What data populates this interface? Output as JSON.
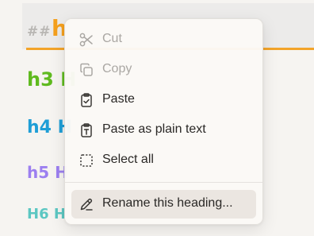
{
  "headings": {
    "h2": {
      "marker": "##",
      "text": "h"
    },
    "h3": {
      "text": "h3 H"
    },
    "h4": {
      "text": "h4 H"
    },
    "h5": {
      "text": "h5 H"
    },
    "h6": {
      "text": "H6 H"
    }
  },
  "context_menu": {
    "items": [
      {
        "label": "Cut",
        "icon": "scissors-icon",
        "disabled": true
      },
      {
        "label": "Copy",
        "icon": "copy-icon",
        "disabled": true
      },
      {
        "label": "Paste",
        "icon": "clipboard-check-icon",
        "disabled": false
      },
      {
        "label": "Paste as plain text",
        "icon": "clipboard-text-icon",
        "disabled": false
      },
      {
        "label": "Select all",
        "icon": "select-all-icon",
        "disabled": false
      },
      {
        "label": "Rename this heading...",
        "icon": "pencil-icon",
        "disabled": false,
        "highlighted": true
      }
    ]
  },
  "colors": {
    "h2": "#f5a01d",
    "h3": "#5fba1f",
    "h4": "#1f9ed6",
    "h5": "#9c7ff0",
    "h6": "#5cc7c2"
  }
}
